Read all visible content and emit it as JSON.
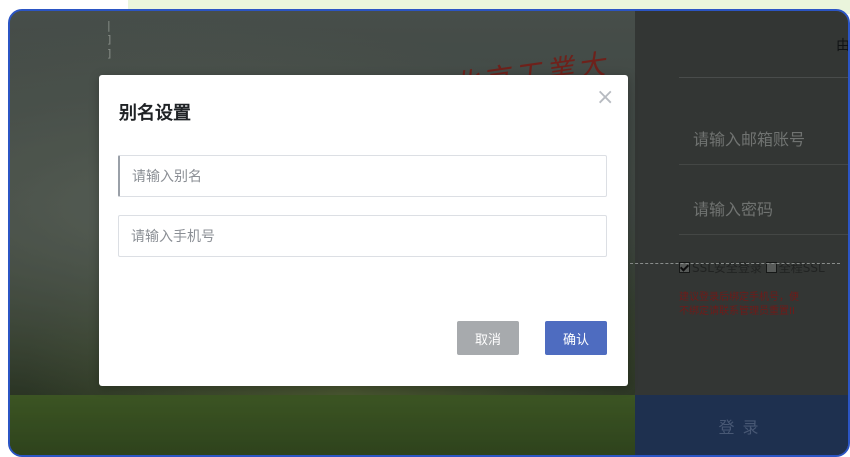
{
  "background": {
    "building_text": "北京工業大學",
    "login_top_text": "由",
    "email_placeholder": "请输入邮箱账号",
    "password_placeholder": "请输入密码",
    "ssl_label": "SSL安全登录",
    "full_ssl_label": "全程SSL",
    "warning_line1": "建议登录后绑定手机号，便",
    "warning_line2": "不绑定请联系管理员重置II",
    "login_button": "登录"
  },
  "modal": {
    "title": "别名设置",
    "close_icon": "×",
    "alias_placeholder": "请输入别名",
    "phone_placeholder": "请输入手机号",
    "cancel_label": "取消",
    "confirm_label": "确认"
  },
  "colors": {
    "frame_border": "#2b55c4",
    "confirm_button": "#4e6cc0",
    "cancel_button": "#a7aaad",
    "warning_text": "#8a2220"
  }
}
